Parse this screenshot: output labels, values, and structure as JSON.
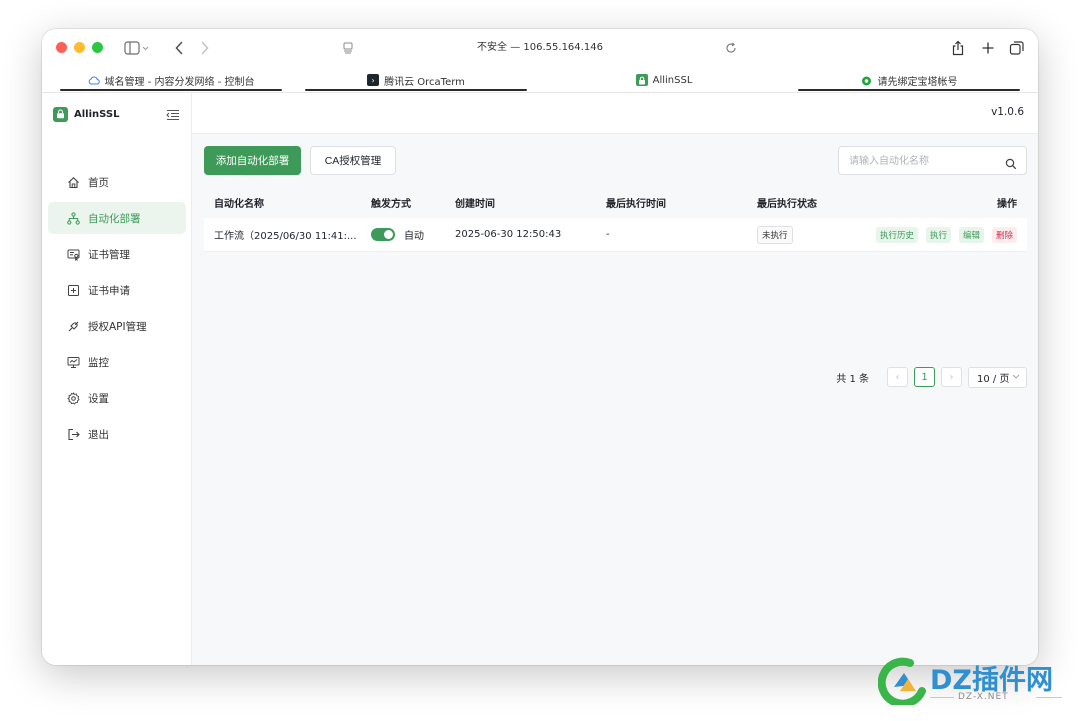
{
  "browser": {
    "address": "不安全 — 106.55.164.146",
    "tabs": [
      {
        "label": "域名管理 - 内容分发网络 - 控制台",
        "icon": "cloud-icon"
      },
      {
        "label": "腾讯云 OrcaTerm",
        "icon": "terminal-icon"
      },
      {
        "label": "AllinSSL",
        "icon": "lock-icon"
      },
      {
        "label": "请先绑定宝塔帐号",
        "icon": "bt-logo-icon"
      }
    ]
  },
  "app": {
    "brand": "AllinSSL",
    "version": "v1.0.6",
    "accent": "#3d9a58"
  },
  "sidebar": {
    "items": [
      {
        "label": "首页",
        "icon": "home-icon"
      },
      {
        "label": "自动化部署",
        "icon": "workflow-icon",
        "active": true
      },
      {
        "label": "证书管理",
        "icon": "certificate-icon"
      },
      {
        "label": "证书申请",
        "icon": "plus-square-icon"
      },
      {
        "label": "授权API管理",
        "icon": "api-key-icon"
      },
      {
        "label": "监控",
        "icon": "monitor-icon"
      },
      {
        "label": "设置",
        "icon": "gear-icon"
      },
      {
        "label": "退出",
        "icon": "logout-icon"
      }
    ]
  },
  "toolbar": {
    "add_label": "添加自动化部署",
    "ca_label": "CA授权管理",
    "search_placeholder": "请输入自动化名称"
  },
  "table": {
    "headers": [
      "自动化名称",
      "触发方式",
      "创建时间",
      "最后执行时间",
      "最后执行状态",
      "操作"
    ],
    "rows": [
      {
        "name": "工作流（2025/06/30 11:41:...",
        "trigger": "自动",
        "trigger_enabled": true,
        "created": "2025-06-30 12:50:43",
        "last_run": "-",
        "status": "未执行",
        "actions": [
          "执行历史",
          "执行",
          "编辑",
          "删除"
        ]
      }
    ]
  },
  "pagination": {
    "total": "共 1 条",
    "prev": "‹",
    "current": "1",
    "next": "›",
    "page_size": "10 / 页"
  },
  "watermark": {
    "title": "DZ插件网",
    "subtitle": "DZ-X.NET"
  }
}
